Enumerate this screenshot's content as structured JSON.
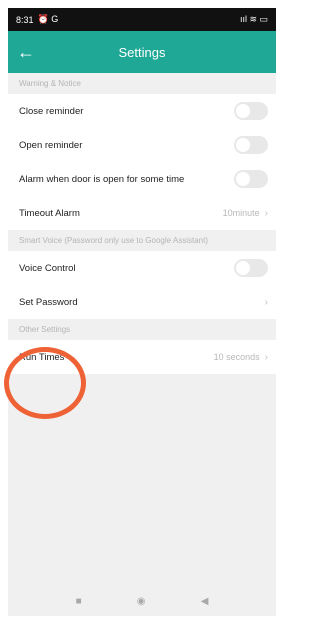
{
  "status": {
    "time": "8:31",
    "left_icons": "⏰ G",
    "right_icons": "ııl ≋ ▭"
  },
  "appbar": {
    "back_symbol": "←",
    "title": "Settings"
  },
  "sections": {
    "warning": {
      "header": "Warning & Notice",
      "close_reminder": "Close reminder",
      "open_reminder": "Open reminder",
      "alarm_open": "Alarm when door is open for some time",
      "timeout_alarm": "Timeout Alarm",
      "timeout_value": "10minute"
    },
    "voice": {
      "header": "Smart Voice (Password only use to Google Assistant)",
      "voice_control": "Voice Control",
      "set_password": "Set Password"
    },
    "other": {
      "header": "Other Settings",
      "run_times": "Run Times",
      "run_times_value": "10 seconds"
    }
  },
  "chevron": "›",
  "nav": {
    "recent": "■",
    "home": "◉",
    "back": "◀"
  },
  "colors": {
    "accent": "#1fa896",
    "highlight": "#ee6236"
  }
}
